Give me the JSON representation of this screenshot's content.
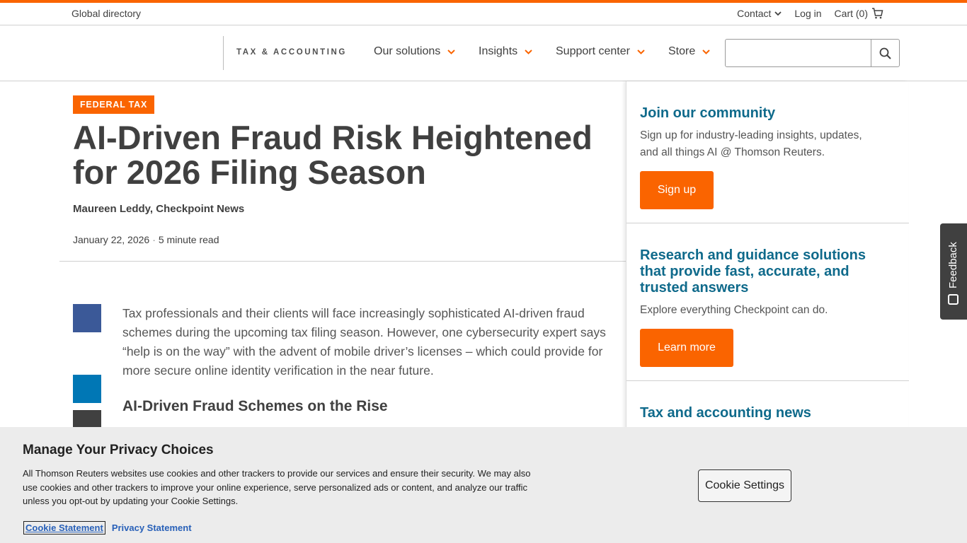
{
  "utility_bar": {
    "global_directory": "Global directory",
    "contact": "Contact",
    "login": "Log in",
    "cart": "Cart (0)"
  },
  "nav": {
    "brand": "TAX & ACCOUNTING",
    "items": [
      "Our solutions",
      "Insights",
      "Support center",
      "Store"
    ],
    "search_placeholder": ""
  },
  "article": {
    "tag": "FEDERAL TAX",
    "headline": "AI-Driven Fraud Risk Heightened for 2026 Filing Season",
    "byline": "Maureen Leddy, Checkpoint News",
    "date": "January 22, 2026",
    "read_time": "5 minute read",
    "paragraph": "Tax professionals and their clients will face increasingly sophisticated AI-driven fraud schemes during the upcoming tax filing season. However, one cybersecurity expert says “help is on the way” with the advent of mobile driver’s licenses – which could provide for more secure online identity verification in the near future.",
    "subheading": "AI-Driven Fraud Schemes on the Rise"
  },
  "sidebar": {
    "community": {
      "title": "Join our community",
      "text": "Sign up for industry-leading insights, updates, and all things AI @ Thomson Reuters.",
      "button": "Sign up"
    },
    "research": {
      "title": "Research and guidance solutions that provide fast, accurate, and trusted answers",
      "text": "Explore everything Checkpoint can do.",
      "button": "Learn more"
    },
    "news": {
      "title": "Tax and accounting news"
    }
  },
  "feedback": "Feedback",
  "privacy": {
    "title": "Manage Your Privacy Choices",
    "text": "All Thomson Reuters websites use cookies and other trackers to provide our services and ensure their security. We may also use cookies and other trackers to improve your online experience, serve personalized ads or content, and analyze our traffic unless you opt-out by updating your Cookie Settings.",
    "cookie_statement": "Cookie Statement",
    "privacy_statement": "Privacy Statement",
    "cookie_settings": "Cookie Settings"
  },
  "colors": {
    "accent": "#fa6400",
    "link_teal": "#0f6a8b",
    "facebook": "#3b5998",
    "linkedin": "#0077b5"
  }
}
